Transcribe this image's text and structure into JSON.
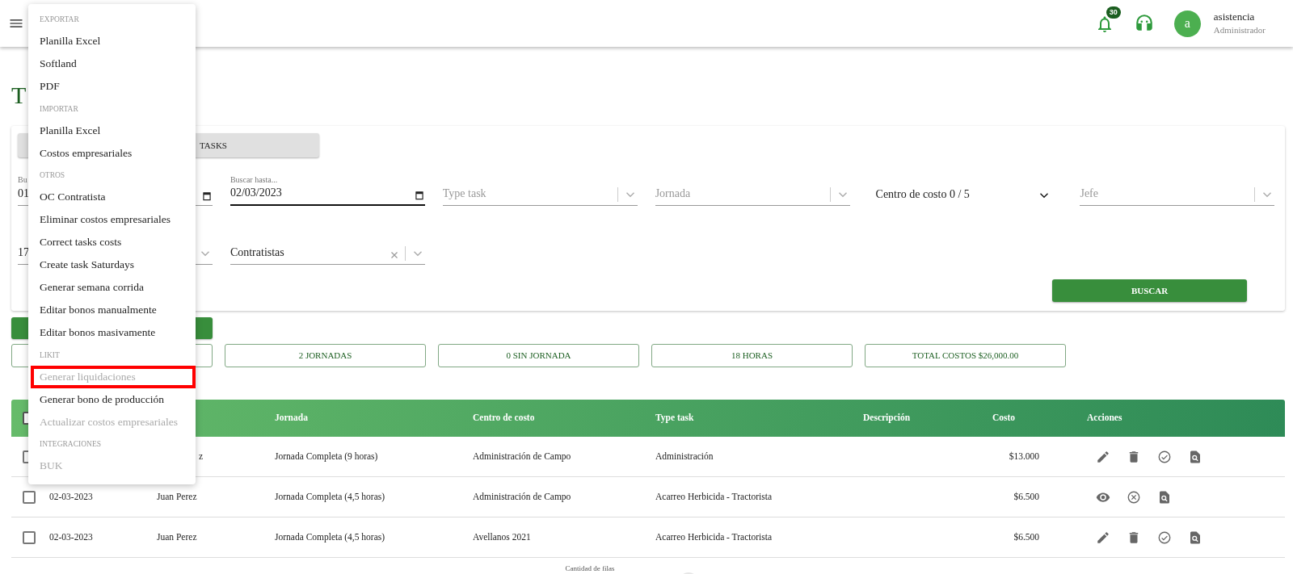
{
  "header": {
    "notifications": "30",
    "avatar_letter": "a",
    "user_name": "asistencia",
    "user_role": "Administrador"
  },
  "page_title": "T",
  "tabs": [
    {
      "label": "TASKS"
    }
  ],
  "filters": [
    {
      "kind": "date",
      "label": "Bu",
      "value": "01",
      "focused": false
    },
    {
      "kind": "date",
      "label": "Buscar hasta...",
      "value": "02/03/2023",
      "focused": true
    },
    {
      "kind": "select",
      "placeholder": "Type task"
    },
    {
      "kind": "select",
      "placeholder": "Jornada"
    },
    {
      "kind": "multiselect",
      "value": "Centro de costo 0 / 5"
    },
    {
      "kind": "select",
      "placeholder": "Jefe"
    },
    {
      "kind": "select",
      "value": "17"
    },
    {
      "kind": "clearable",
      "value": "Contratistas"
    }
  ],
  "search_button": "BUSCAR",
  "summary": [
    "2 JORNADAS",
    "0 SIN JORNADA",
    "18 HORAS",
    "TOTAL COSTOS $26,000.00"
  ],
  "table": {
    "all_checked": false,
    "columns": [
      "Jornada",
      "Centro de costo",
      "Type task",
      "Descripción",
      "Costo",
      "Acciones"
    ],
    "rows": [
      {
        "checked": false,
        "worker": "z",
        "jornada": "Jornada Completa (9 horas)",
        "centro": "Administración de Campo",
        "type_task": "Administración",
        "cost": "$13.000",
        "actions": [
          {
            "kind": "edit"
          },
          {
            "kind": "delete"
          },
          {
            "kind": "approve"
          },
          {
            "kind": "detail"
          }
        ]
      },
      {
        "checked": false,
        "date": "02-03-2023",
        "worker": "Juan Perez",
        "jornada": "Jornada Completa (4,5 horas)",
        "centro": "Administración de Campo",
        "type_task": "Acarreo Herbicida - Tractorista",
        "cost": "$6.500",
        "actions": [
          {
            "kind": "view"
          },
          {
            "kind": "cancel"
          },
          {
            "kind": "detail"
          }
        ]
      },
      {
        "checked": false,
        "date": "02-03-2023",
        "worker": "Juan Perez",
        "jornada": "Jornada Completa (4,5 horas)",
        "centro": "Avellanos 2021",
        "type_task": "Acarreo Herbicida - Tractorista",
        "cost": "$6.500",
        "actions": [
          {
            "kind": "edit"
          },
          {
            "kind": "delete"
          },
          {
            "kind": "approve"
          },
          {
            "kind": "detail"
          }
        ]
      }
    ]
  },
  "footer": {
    "rows_label": "Cantidad de filas"
  },
  "menu": [
    {
      "kind": "header",
      "label": "EXPORTAR"
    },
    {
      "kind": "item",
      "label": "Planilla Excel",
      "disabled": false,
      "highlighted": false
    },
    {
      "kind": "item",
      "label": "Softland",
      "disabled": false,
      "highlighted": false
    },
    {
      "kind": "item",
      "label": "PDF",
      "disabled": false,
      "highlighted": false
    },
    {
      "kind": "header",
      "label": "IMPORTAR"
    },
    {
      "kind": "item",
      "label": "Planilla Excel",
      "disabled": false,
      "highlighted": false
    },
    {
      "kind": "item",
      "label": "Costos empresariales",
      "disabled": false,
      "highlighted": false
    },
    {
      "kind": "header",
      "label": "OTROS"
    },
    {
      "kind": "item",
      "label": "OC Contratista",
      "disabled": false,
      "highlighted": false
    },
    {
      "kind": "item",
      "label": "Eliminar costos empresariales",
      "disabled": false,
      "highlighted": false
    },
    {
      "kind": "item",
      "label": "Correct tasks costs",
      "disabled": false,
      "highlighted": false
    },
    {
      "kind": "item",
      "label": "Create task Saturdays",
      "disabled": false,
      "highlighted": false
    },
    {
      "kind": "item",
      "label": "Generar semana corrida",
      "disabled": false,
      "highlighted": false
    },
    {
      "kind": "item",
      "label": "Editar bonos manualmente",
      "disabled": false,
      "highlighted": false
    },
    {
      "kind": "item",
      "label": "Editar bonos masivamente",
      "disabled": false,
      "highlighted": false
    },
    {
      "kind": "header",
      "label": "LIKIT"
    },
    {
      "kind": "item",
      "label": "Generar liquidaciones",
      "disabled": true,
      "highlighted": true
    },
    {
      "kind": "item",
      "label": "Generar bono de producción",
      "disabled": false,
      "highlighted": false
    },
    {
      "kind": "item",
      "label": "Actualizar costos empresariales",
      "disabled": true,
      "highlighted": false
    },
    {
      "kind": "header",
      "label": "INTEGRACIONES"
    },
    {
      "kind": "item",
      "label": "BUK",
      "disabled": true,
      "highlighted": false
    }
  ]
}
